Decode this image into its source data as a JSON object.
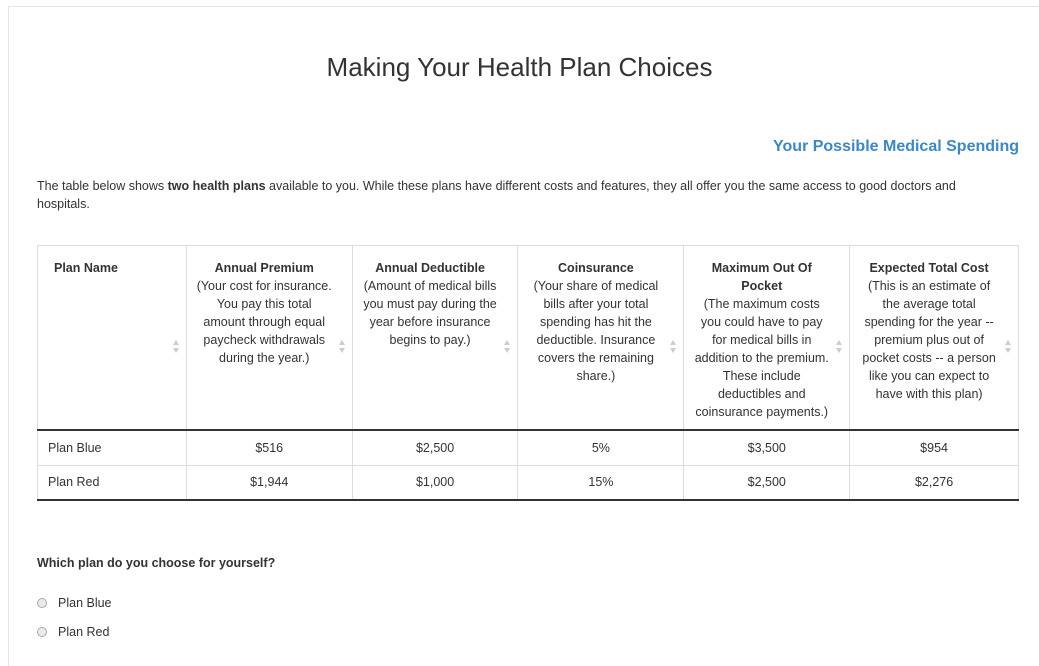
{
  "page": {
    "title": "Making Your Health Plan Choices",
    "section_link": "Your Possible Medical Spending",
    "intro_before": "The table below shows ",
    "intro_bold": "two health plans",
    "intro_after": " available to you. While these plans have different costs and features, they all offer you the same access to good doctors and hospitals."
  },
  "table": {
    "columns": [
      {
        "title": "Plan Name",
        "desc": ""
      },
      {
        "title": "Annual Premium",
        "desc": "(Your cost for insurance. You pay this total amount through equal paycheck withdrawals during the year.)"
      },
      {
        "title": "Annual Deductible",
        "desc": "(Amount of medical bills you must pay during the year before insurance begins to pay.)"
      },
      {
        "title": "Coinsurance",
        "desc": "(Your share of medical bills after your total spending has hit the deductible. Insurance covers the remaining share.)"
      },
      {
        "title": "Maximum Out Of Pocket",
        "desc": "(The maximum costs you could have to pay for medical bills in addition to the premium. These include deductibles and coinsurance payments.)"
      },
      {
        "title": "Expected Total Cost",
        "desc": "(This is an estimate of the average total spending for the year -- premium plus out of pocket costs -- a person like you can expect to have with this plan)"
      }
    ],
    "rows": [
      [
        "Plan Blue",
        "$516",
        "$2,500",
        "5%",
        "$3,500",
        "$954"
      ],
      [
        "Plan Red",
        "$1,944",
        "$1,000",
        "15%",
        "$2,500",
        "$2,276"
      ]
    ]
  },
  "question": {
    "label": "Which plan do you choose for yourself?",
    "options": [
      "Plan Blue",
      "Plan Red"
    ]
  },
  "colors": {
    "accent": "#3a87c9",
    "text": "#333333",
    "border": "#dddddd"
  }
}
